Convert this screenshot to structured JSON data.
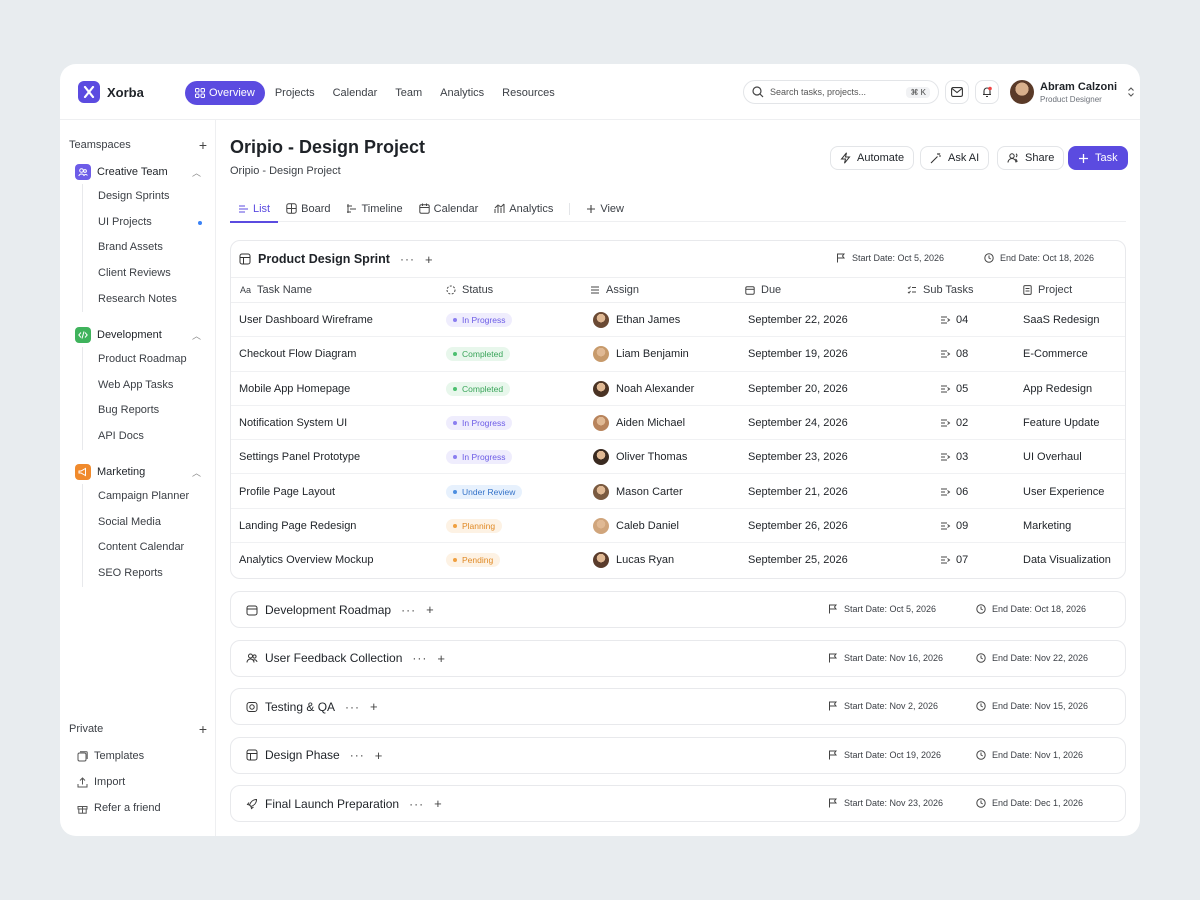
{
  "app": {
    "name": "Xorba"
  },
  "nav": [
    {
      "label": "Overview",
      "active": true
    },
    {
      "label": "Projects"
    },
    {
      "label": "Calendar"
    },
    {
      "label": "Team"
    },
    {
      "label": "Analytics"
    },
    {
      "label": "Resources"
    }
  ],
  "search": {
    "placeholder": "Search tasks, projects...",
    "shortcut": "⌘ K"
  },
  "user": {
    "name": "Abram Calzoni",
    "role": "Product Designer"
  },
  "sidebar": {
    "teamspaces_label": "Teamspaces",
    "groups": [
      {
        "label": "Creative Team",
        "color": "#6d5ce8",
        "items": [
          "Design Sprints",
          "UI Projects",
          "Brand Assets",
          "Client Reviews",
          "Research Notes"
        ]
      },
      {
        "label": "Development",
        "color": "#3fb35c",
        "items": [
          "Product Roadmap",
          "Web App Tasks",
          "Bug Reports",
          "API Docs"
        ]
      },
      {
        "label": "Marketing",
        "color": "#f08a2c",
        "items": [
          "Campaign Planner",
          "Social Media",
          "Content Calendar",
          "SEO Reports"
        ]
      }
    ],
    "private_label": "Private",
    "footer": [
      "Templates",
      "Import",
      "Refer a friend"
    ]
  },
  "page": {
    "title": "Oripio - Design Project",
    "subtitle": "Oripio - Design Project"
  },
  "actions": {
    "automate": "Automate",
    "ask_ai": "Ask AI",
    "share": "Share",
    "task": "Task"
  },
  "tabs": [
    {
      "label": "List",
      "active": true
    },
    {
      "label": "Board"
    },
    {
      "label": "Timeline"
    },
    {
      "label": "Calendar"
    },
    {
      "label": "Analytics"
    },
    {
      "label": "View"
    }
  ],
  "columns": {
    "task": "Task Name",
    "status": "Status",
    "assign": "Assign",
    "due": "Due",
    "subtasks": "Sub Tasks",
    "project": "Project"
  },
  "sprint": {
    "title": "Product Design Sprint",
    "start": "Start Date: Oct 5, 2026",
    "end": "End Date: Oct 18, 2026",
    "rows": [
      {
        "task": "User Dashboard Wireframe",
        "status": "In Progress",
        "assignee": "Ethan James",
        "due": "September 22, 2026",
        "subtasks": "04",
        "project": "SaaS Redesign"
      },
      {
        "task": "Checkout Flow Diagram",
        "status": "Completed",
        "assignee": "Liam Benjamin",
        "due": "September 19, 2026",
        "subtasks": "08",
        "project": "E-Commerce"
      },
      {
        "task": "Mobile App Homepage",
        "status": "Completed",
        "assignee": "Noah Alexander",
        "due": "September 20, 2026",
        "subtasks": "05",
        "project": "App Redesign"
      },
      {
        "task": "Notification System UI",
        "status": "In Progress",
        "assignee": "Aiden Michael",
        "due": "September 24, 2026",
        "subtasks": "02",
        "project": "Feature Update"
      },
      {
        "task": "Settings Panel Prototype",
        "status": "In Progress",
        "assignee": "Oliver Thomas",
        "due": "September 23, 2026",
        "subtasks": "03",
        "project": "UI Overhaul"
      },
      {
        "task": "Profile Page Layout",
        "status": "Under Review",
        "assignee": "Mason Carter",
        "due": "September 21, 2026",
        "subtasks": "06",
        "project": "User Experience"
      },
      {
        "task": "Landing Page Redesign",
        "status": "Planning",
        "assignee": "Caleb Daniel",
        "due": "September 26, 2026",
        "subtasks": "09",
        "project": "Marketing"
      },
      {
        "task": "Analytics Overview Mockup",
        "status": "Pending",
        "assignee": "Lucas Ryan",
        "due": "September 25, 2026",
        "subtasks": "07",
        "project": "Data Visualization"
      }
    ]
  },
  "status_colors": {
    "In Progress": {
      "bg": "#efedfd",
      "fg": "#6b5be6",
      "dot": "#8b7ef0"
    },
    "Completed": {
      "bg": "#e8f7ec",
      "fg": "#3aa55a",
      "dot": "#4cc070"
    },
    "Under Review": {
      "bg": "#e7f1fd",
      "fg": "#3573c9",
      "dot": "#4d8ee0"
    },
    "Planning": {
      "bg": "#fdf2e4",
      "fg": "#e08a26",
      "dot": "#f0a040"
    },
    "Pending": {
      "bg": "#fdf2e4",
      "fg": "#e08a26",
      "dot": "#f0a040"
    }
  },
  "sections": [
    {
      "title": "Development Roadmap",
      "icon": "calendar-icon",
      "start": "Start Date: Oct 5, 2026",
      "end": "End Date: Oct 18, 2026"
    },
    {
      "title": "User Feedback Collection",
      "icon": "users-icon",
      "start": "Start Date: Nov 16, 2026",
      "end": "End Date: Nov 22, 2026"
    },
    {
      "title": "Testing & QA",
      "icon": "camera-icon",
      "start": "Start Date: Nov 2, 2026",
      "end": "End Date: Nov 15, 2026"
    },
    {
      "title": "Design Phase",
      "icon": "table-icon",
      "start": "Start Date: Oct 19, 2026",
      "end": "End Date: Nov 1, 2026"
    },
    {
      "title": "Final Launch Preparation",
      "icon": "rocket-icon",
      "start": "Start Date: Nov 23, 2026",
      "end": "End Date: Dec 1, 2026"
    }
  ]
}
